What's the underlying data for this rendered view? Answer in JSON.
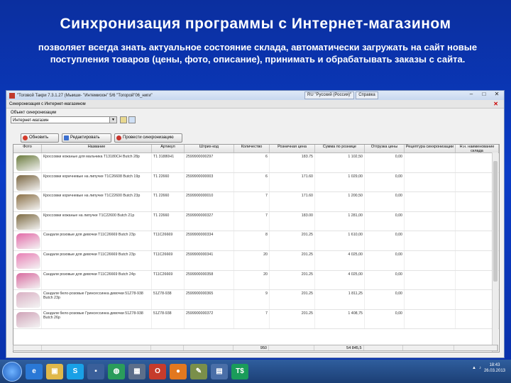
{
  "slide": {
    "title": "Синхронизация программы с Интернет-магазином",
    "subtitle": "позволяет всегда знать актуальное состояние склада, автоматически загружать на сайт новые поступления товаров (цены, фото, описание), принимать и обрабатывать заказы с сайта."
  },
  "window": {
    "title": "\"Тоговой Такри 7.3.1.27 (Мыиши- \"Интемиоон\" 5/6 \"Тогорой\"06_ниги\"",
    "top_buttons": [
      "RU \"Русский (Россия)\"",
      "Справка"
    ],
    "subtitle": "Синхронизация с Интернет-магазином",
    "object_label": "Объект синхронизации",
    "object_value": "Интернет-магазин"
  },
  "toolbar": {
    "refresh": "Обновить",
    "edit": "Редактировать",
    "sync": "Провести синхронизацию"
  },
  "columns": [
    "Фото",
    "Название",
    "Артикул",
    "Штрих-код",
    "Количество",
    "Розничная цена",
    "Сумма по рознице",
    "Отгрузка цены",
    "Рецептура синхронизации",
    "Н.н. наименование склада"
  ],
  "rows": [
    {
      "name": "Кроссовки кожаные для мальчика T13180CH Butch 28р",
      "sku": "T1 31880H1",
      "barcode": "2599900000297",
      "qty": "6",
      "price": "183.75",
      "sum": "1 102,50",
      "ship": "0,00",
      "extra": "0",
      "color": "#6a7a3c"
    },
    {
      "name": "Кроссовки коричневые на липучке T1C26608 Butch 19р",
      "sku": "T1 22660",
      "barcode": "2599900000003",
      "qty": "6",
      "price": "171.60",
      "sum": "1 029,00",
      "ship": "0,00",
      "extra": "0",
      "color": "#7a6540"
    },
    {
      "name": "Кроссовки коричневые на липучке T1C22600 Butch 23р",
      "sku": "T1 22660",
      "barcode": "2599900000010",
      "qty": "7",
      "price": "171.60",
      "sum": "1 200,50",
      "ship": "0,00",
      "extra": "0",
      "color": "#8a6f45"
    },
    {
      "name": "Кроссовки кожаные на липучке T1C22600 Butch 21р",
      "sku": "T1 22660",
      "barcode": "2599900000327",
      "qty": "7",
      "price": "183.00",
      "sum": "1 281,00",
      "ship": "0,00",
      "extra": "0",
      "color": "#7d6a42"
    },
    {
      "name": "Сандали розовые для девочки T11C26669 Butch 23р",
      "sku": "T11C26669",
      "barcode": "2599900000334",
      "qty": "8",
      "price": "201.25",
      "sum": "1 610,00",
      "ship": "0,00",
      "extra": "0",
      "color": "#e26aa8"
    },
    {
      "name": "Сандали розовые для девочки T11C26669 Butch 23р",
      "sku": "T11C26669",
      "barcode": "2599900000341",
      "qty": "20",
      "price": "201.25",
      "sum": "4 025,00",
      "ship": "0,00",
      "extra": "0",
      "color": "#e87fb5"
    },
    {
      "name": "Сандали розовые для девочки T11C26669 Butch 24р",
      "sku": "T11C26669",
      "barcode": "2599900000358",
      "qty": "20",
      "price": "201.25",
      "sum": "4 025,00",
      "ship": "0,00",
      "extra": "0",
      "color": "#d86a9f"
    },
    {
      "name": "Сандали бело-розовые Гринсессинка девочки 51Z78-938 Butch 23р",
      "sku": "51Z78-938",
      "barcode": "2599900000365",
      "qty": "9",
      "price": "201.25",
      "sum": "1 811,25",
      "ship": "0,00",
      "extra": "0",
      "color": "#d9b0c3"
    },
    {
      "name": "Сандали бело-розовые Гринсессинка девочки 51Z78-938 Butch 26р",
      "sku": "51Z78-938",
      "barcode": "2599900000372",
      "qty": "7",
      "price": "201.25",
      "sum": "1 408,75",
      "ship": "0,00",
      "extra": "0",
      "color": "#cfa2b7"
    }
  ],
  "totals": {
    "qty": "950",
    "sum": "54 845,5"
  },
  "taskbar": {
    "icons": [
      {
        "name": "windows-start-icon",
        "color": "#1f5fbf",
        "glyph": ""
      },
      {
        "name": "ie-icon",
        "color": "#2a78d6",
        "glyph": "e"
      },
      {
        "name": "folder-icon",
        "color": "#e0b84a",
        "glyph": "▣"
      },
      {
        "name": "skype-icon",
        "color": "#19a0e6",
        "glyph": "S"
      },
      {
        "name": "save-icon",
        "color": "#3a5f9a",
        "glyph": "▪"
      },
      {
        "name": "globe-icon",
        "color": "#2a9c5b",
        "glyph": "◍"
      },
      {
        "name": "calculator-icon",
        "color": "#5c6e8a",
        "glyph": "▦"
      },
      {
        "name": "opera-icon",
        "color": "#c63b2b",
        "glyph": "O"
      },
      {
        "name": "firefox-icon",
        "color": "#e2781f",
        "glyph": "●"
      },
      {
        "name": "pen-icon",
        "color": "#7a8f4a",
        "glyph": "✎"
      },
      {
        "name": "windows-icon",
        "color": "#4a6fa8",
        "glyph": "▤"
      },
      {
        "name": "ts-app-icon",
        "color": "#1a9c5a",
        "glyph": "T$"
      }
    ],
    "time": "18:43",
    "date": "26.03.2013"
  }
}
